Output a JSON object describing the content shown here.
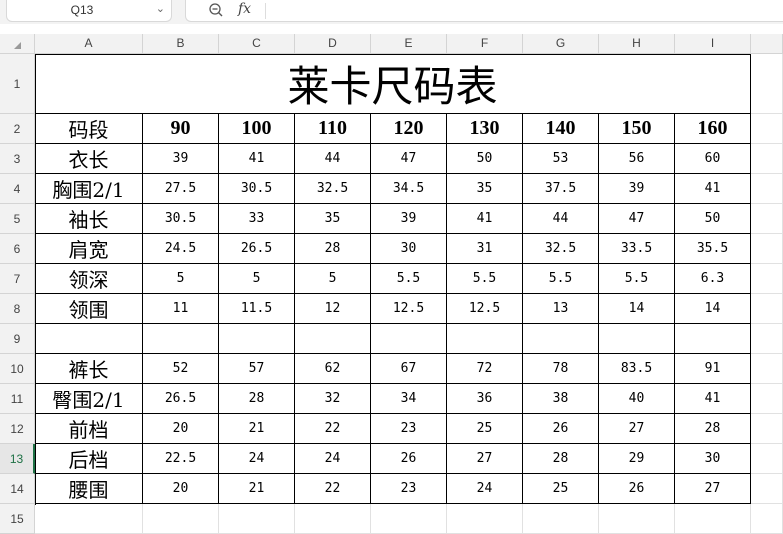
{
  "formula_bar": {
    "name_box": "Q13",
    "fx_label": "fx",
    "formula_value": ""
  },
  "columns": [
    "A",
    "B",
    "C",
    "D",
    "E",
    "F",
    "G",
    "H",
    "I"
  ],
  "rows": [
    "1",
    "2",
    "3",
    "4",
    "5",
    "6",
    "7",
    "8",
    "9",
    "10",
    "11",
    "12",
    "13",
    "14",
    "15"
  ],
  "selected_row": "13",
  "sheet": {
    "title": "莱卡尺码表",
    "size_header": [
      "码段",
      "90",
      "100",
      "110",
      "120",
      "130",
      "140",
      "150",
      "160"
    ],
    "top_rows": [
      [
        "衣长",
        "39",
        "41",
        "44",
        "47",
        "50",
        "53",
        "56",
        "60"
      ],
      [
        "胸围2/1",
        "27.5",
        "30.5",
        "32.5",
        "34.5",
        "35",
        "37.5",
        "39",
        "41"
      ],
      [
        "袖长",
        "30.5",
        "33",
        "35",
        "39",
        "41",
        "44",
        "47",
        "50"
      ],
      [
        "肩宽",
        "24.5",
        "26.5",
        "28",
        "30",
        "31",
        "32.5",
        "33.5",
        "35.5"
      ],
      [
        "领深",
        "5",
        "5",
        "5",
        "5.5",
        "5.5",
        "5.5",
        "5.5",
        "6.3"
      ],
      [
        "领围",
        "11",
        "11.5",
        "12",
        "12.5",
        "12.5",
        "13",
        "14",
        "14"
      ]
    ],
    "bottom_rows": [
      [
        "裤长",
        "52",
        "57",
        "62",
        "67",
        "72",
        "78",
        "83.5",
        "91"
      ],
      [
        "臀围2/1",
        "26.5",
        "28",
        "32",
        "34",
        "36",
        "38",
        "40",
        "41"
      ],
      [
        "前档",
        "20",
        "21",
        "22",
        "23",
        "25",
        "26",
        "27",
        "28"
      ],
      [
        "后档",
        "22.5",
        "24",
        "24",
        "26",
        "27",
        "28",
        "29",
        "30"
      ],
      [
        "腰围",
        "20",
        "21",
        "22",
        "23",
        "24",
        "25",
        "26",
        "27"
      ]
    ]
  }
}
